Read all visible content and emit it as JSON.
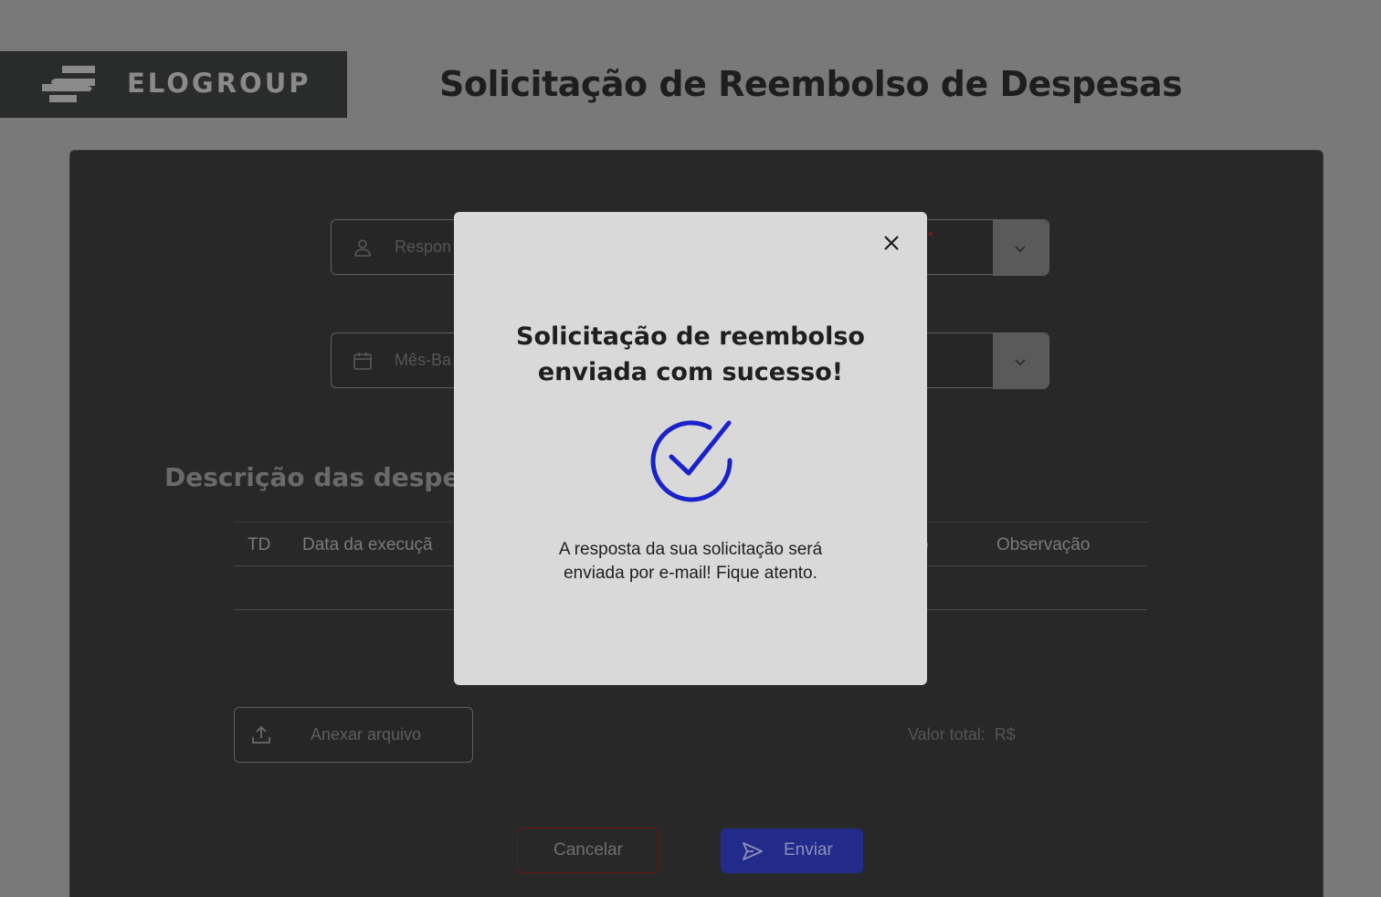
{
  "header": {
    "logo_text": "ELOGROUP",
    "title": "Solicitação de Reembolso de Despesas"
  },
  "form": {
    "responsavel_placeholder": "Respon",
    "mes_placeholder": "Mês-Ba",
    "responsavel_icon": "user-icon",
    "mes_icon": "calendar-icon",
    "dropdown_icon": "chevron-down-icon"
  },
  "expenses": {
    "section_title": "Descrição das despes",
    "columns": [
      "TD",
      "Data da execuçã",
      "o",
      "Observação"
    ]
  },
  "attach": {
    "label": "Anexar arquivo",
    "icon": "upload-icon"
  },
  "total": {
    "label": "Valor total:",
    "currency": "R$"
  },
  "actions": {
    "cancel_label": "Cancelar",
    "send_label": "Enviar",
    "send_icon": "send-icon"
  },
  "modal": {
    "title": "Solicitação de reembolso\nenviada com sucesso!",
    "message": "A resposta da sua solicitação será\nenviada por e-mail! Fique atento.",
    "close_icon": "close-icon",
    "status_icon": "check-circle-icon"
  },
  "colors": {
    "background": "#797979",
    "panel": "#282828",
    "modal": "#d9d9d9",
    "accent_blue": "#1a23c9",
    "cancel_border": "#6a1313"
  }
}
